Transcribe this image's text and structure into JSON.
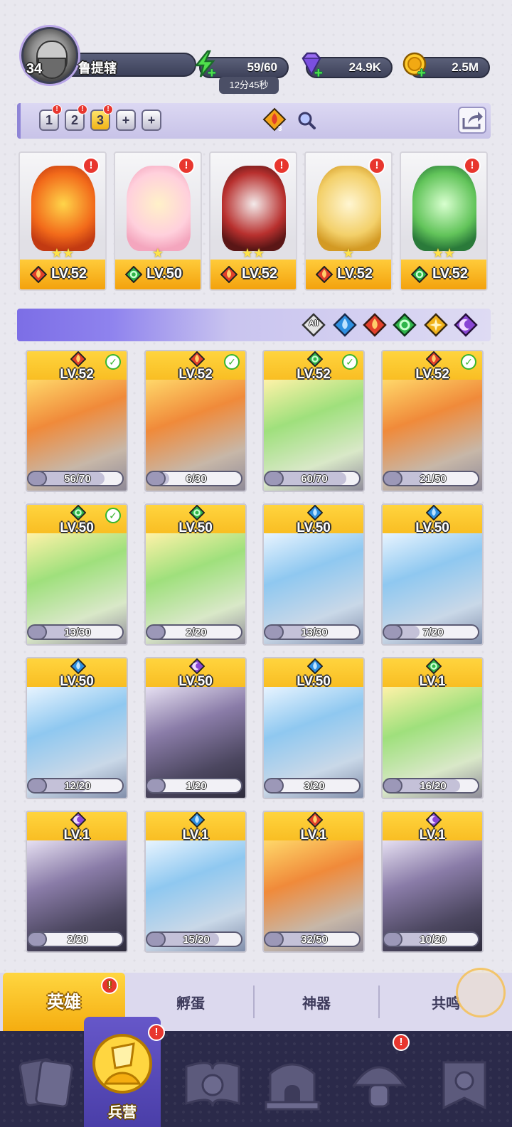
{
  "player": {
    "level": "34",
    "name": "鲁提辖"
  },
  "resources": {
    "energy": {
      "value": "59/60",
      "icon": "lightning-icon",
      "timer": "12分45秒"
    },
    "gems": {
      "value": "24.9K",
      "icon": "diamond-icon"
    },
    "gold": {
      "value": "2.5M",
      "icon": "coin-icon"
    }
  },
  "team_bar": {
    "slots": [
      "1",
      "2",
      "3",
      "+",
      "+"
    ],
    "active_slot": "3",
    "badge_count": "3"
  },
  "team_heroes": [
    {
      "level": "LV.52",
      "element": "fire",
      "stars": "★★"
    },
    {
      "level": "LV.50",
      "element": "wind",
      "stars": "★"
    },
    {
      "level": "LV.52",
      "element": "fire",
      "stars": "★★"
    },
    {
      "level": "LV.52",
      "element": "fire",
      "stars": "★"
    },
    {
      "level": "LV.52",
      "element": "wind",
      "stars": "★★"
    }
  ],
  "filters": [
    "All",
    "water",
    "fire",
    "wind",
    "light",
    "dark"
  ],
  "filter_all_label": "All",
  "heroes": [
    {
      "level": "LV.52",
      "element": "fire",
      "progress": "56/70",
      "fraction": 0.8,
      "check": true
    },
    {
      "level": "LV.52",
      "element": "fire",
      "progress": "6/30",
      "fraction": 0.2,
      "check": true
    },
    {
      "level": "LV.52",
      "element": "wind",
      "progress": "60/70",
      "fraction": 0.857,
      "check": true
    },
    {
      "level": "LV.52",
      "element": "fire",
      "progress": "21/50",
      "fraction": 0.42,
      "check": true
    },
    {
      "level": "LV.50",
      "element": "wind",
      "progress": "13/30",
      "fraction": 0.433,
      "check": true
    },
    {
      "level": "LV.50",
      "element": "wind",
      "progress": "2/20",
      "fraction": 0.1,
      "check": false
    },
    {
      "level": "LV.50",
      "element": "water",
      "progress": "13/30",
      "fraction": 0.433,
      "check": false
    },
    {
      "level": "LV.50",
      "element": "water",
      "progress": "7/20",
      "fraction": 0.35,
      "check": false
    },
    {
      "level": "LV.50",
      "element": "water",
      "progress": "12/20",
      "fraction": 0.6,
      "check": false
    },
    {
      "level": "LV.50",
      "element": "dark",
      "progress": "1/20",
      "fraction": 0.05,
      "check": false
    },
    {
      "level": "LV.50",
      "element": "water",
      "progress": "3/20",
      "fraction": 0.15,
      "check": false
    },
    {
      "level": "LV.1",
      "element": "wind",
      "progress": "16/20",
      "fraction": 0.8,
      "check": false
    },
    {
      "level": "LV.1",
      "element": "dark",
      "progress": "2/20",
      "fraction": 0.1,
      "check": false
    },
    {
      "level": "LV.1",
      "element": "water",
      "progress": "15/20",
      "fraction": 0.75,
      "check": false
    },
    {
      "level": "LV.1",
      "element": "fire",
      "progress": "32/50",
      "fraction": 0.64,
      "check": false
    },
    {
      "level": "LV.1",
      "element": "dark",
      "progress": "10/20",
      "fraction": 0.5,
      "check": false
    }
  ],
  "sub_tabs": [
    {
      "label": "英雄",
      "active": true,
      "alert": true
    },
    {
      "label": "孵蛋",
      "active": false,
      "alert": false
    },
    {
      "label": "神器",
      "active": false,
      "alert": false
    },
    {
      "label": "共鸣",
      "active": false,
      "alert": false
    }
  ],
  "bottom_nav": [
    {
      "label": "",
      "icon": "cards-icon"
    },
    {
      "label": "兵营",
      "icon": "barracks-icon",
      "active": true,
      "alert": true
    },
    {
      "label": "",
      "icon": "book-icon"
    },
    {
      "label": "",
      "icon": "castle-icon"
    },
    {
      "label": "",
      "icon": "mushroom-icon",
      "alert": true
    },
    {
      "label": "",
      "icon": "banner-icon"
    }
  ],
  "colors": {
    "gold": "#f6b417",
    "purple": "#7c6ee6",
    "alert": "#e8362e",
    "fire": "#e2402a",
    "wind": "#2fb54a",
    "water": "#2e8fe0",
    "light": "#f0b21a",
    "dark": "#8a47d4"
  }
}
